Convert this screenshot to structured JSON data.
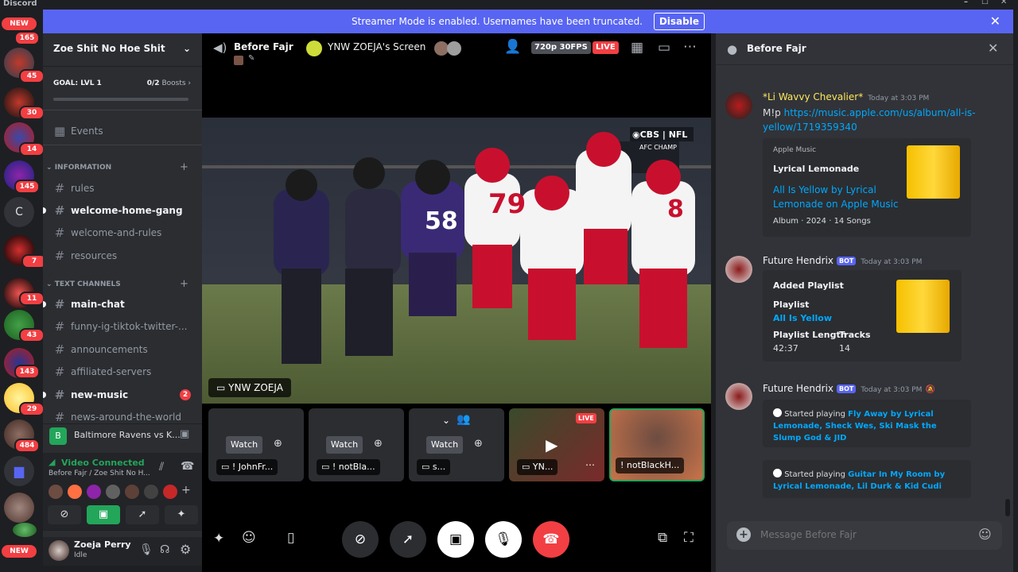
{
  "app": {
    "title": "Discord",
    "window_controls": [
      "–",
      "☐",
      "✕"
    ]
  },
  "banner": {
    "text": "Streamer Mode is enabled. Usernames have been truncated.",
    "disable_label": "Disable"
  },
  "servers": {
    "top_badge": "165",
    "new_label": "NEW",
    "items": [
      {
        "badge": "45"
      },
      {
        "badge": "30"
      },
      {
        "badge": "14"
      },
      {
        "badge": "145"
      },
      {
        "letter": "C",
        "badge": ""
      },
      {
        "badge": "7"
      },
      {
        "badge": "11"
      },
      {
        "badge": "43"
      },
      {
        "badge": "143"
      },
      {
        "badge": "29"
      },
      {
        "badge": "484"
      }
    ],
    "bottom_new": "NEW"
  },
  "guild": {
    "name": "Zoe Shit No Hoe Shit",
    "goal": "GOAL: LVL 1",
    "boosts_count": "0/2",
    "boosts_label": "Boosts",
    "events": "Events"
  },
  "categories": {
    "information": "INFORMATION",
    "text": "TEXT CHANNELS"
  },
  "channels": {
    "information": [
      {
        "name": "rules"
      },
      {
        "name": "welcome-home-gang"
      },
      {
        "name": "welcome-and-rules"
      },
      {
        "name": "resources"
      }
    ],
    "text": [
      {
        "name": "main-chat"
      },
      {
        "name": "funny-ig-tiktok-twitter-..."
      },
      {
        "name": "announcements"
      },
      {
        "name": "affiliated-servers"
      },
      {
        "name": "new-music",
        "mentions": "2"
      },
      {
        "name": "news-around-the-world"
      }
    ]
  },
  "event_bar": {
    "text": "Baltimore Ravens vs K..."
  },
  "voice": {
    "status": "Video Connected",
    "location": "Before Fajr / Zoe Shit No H..."
  },
  "user": {
    "name": "Zoeja Perry",
    "status": "Idle"
  },
  "stream": {
    "channel": "Before Fajr",
    "screen_title": "YNW ZOEJA's Screen",
    "quality": "720p 30FPS",
    "live": "LIVE",
    "overlay_name": "YNW ZOEJA",
    "network": "CBS",
    "league": "NFL",
    "game_label": "AFC CHAMP",
    "tiles": [
      {
        "watch": "Watch",
        "label": "! JohnFr..."
      },
      {
        "watch": "Watch",
        "label": "! notBla..."
      },
      {
        "watch": "Watch",
        "label": "s..."
      },
      {
        "label": "YN...",
        "live": "LIVE"
      },
      {
        "label": "! notBlackH..."
      }
    ]
  },
  "chat": {
    "header": "Before Fajr",
    "messages": [
      {
        "author": "*Li Wavvy Chevalier*",
        "time": "Today at 3:03 PM",
        "prefix": "M!p",
        "link": "https://music.apple.com/us/album/all-is-yellow/1719359340",
        "embed": {
          "provider": "Apple Music",
          "author": "Lyrical Lemonade",
          "title": "All Is Yellow by Lyrical Lemonade on Apple Music",
          "desc": "Album · 2024 · 14 Songs"
        }
      },
      {
        "author": "Future Hendrix",
        "bot": "BOT",
        "time": "Today at 3:03 PM",
        "embed": {
          "title": "Added Playlist",
          "field1_name": "Playlist",
          "field1_value": "All Is Yellow",
          "field2_name": "Playlist Length",
          "field2_value": "42:37",
          "field3_name": "Tracks",
          "field3_value": "14"
        }
      },
      {
        "author": "Future Hendrix",
        "bot": "BOT",
        "time": "Today at 3:03 PM",
        "embeds": [
          {
            "prefix": "Started playing",
            "track": "Fly Away by Lyrical Lemonade, Sheck Wes, Ski Mask the Slump God & JID"
          },
          {
            "prefix": "Started playing",
            "track": "Guitar In My Room by Lyrical Lemonade, Lil Durk & Kid Cudi"
          }
        ]
      }
    ],
    "placeholder": "Message Before Fajr"
  },
  "colors": {
    "blurple": "#5865f2",
    "red": "#f23f43",
    "green": "#23a55a",
    "link": "#00a8fc",
    "bg": "#313338"
  }
}
